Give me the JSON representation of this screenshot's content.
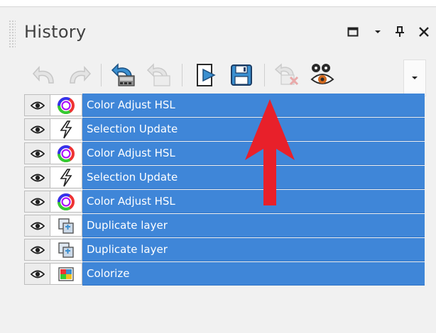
{
  "panel": {
    "title": "History",
    "window_buttons": [
      "maximize-icon",
      "dropdown-icon",
      "pin-icon",
      "close-icon"
    ]
  },
  "toolbar": {
    "buttons": [
      "undo-icon",
      "redo-icon",
      "revert-icon",
      "revert-disabled-icon",
      "play-icon",
      "save-icon",
      "clear-history-icon",
      "visibility-icon"
    ],
    "dropdown": "chevron-down-icon"
  },
  "history": {
    "items": [
      {
        "label": "Color Adjust HSL",
        "icon": "color-wheel-icon"
      },
      {
        "label": "Selection Update",
        "icon": "lightning-icon"
      },
      {
        "label": "Color Adjust HSL",
        "icon": "color-wheel-icon"
      },
      {
        "label": "Selection Update",
        "icon": "lightning-icon"
      },
      {
        "label": "Color Adjust HSL",
        "icon": "color-wheel-icon"
      },
      {
        "label": "Duplicate layer",
        "icon": "duplicate-layer-icon"
      },
      {
        "label": "Duplicate layer",
        "icon": "duplicate-layer-icon"
      },
      {
        "label": "Colorize",
        "icon": "colorize-icon"
      }
    ]
  },
  "colors": {
    "selection": "#3f86d8",
    "annotation_arrow": "#e8202a"
  }
}
